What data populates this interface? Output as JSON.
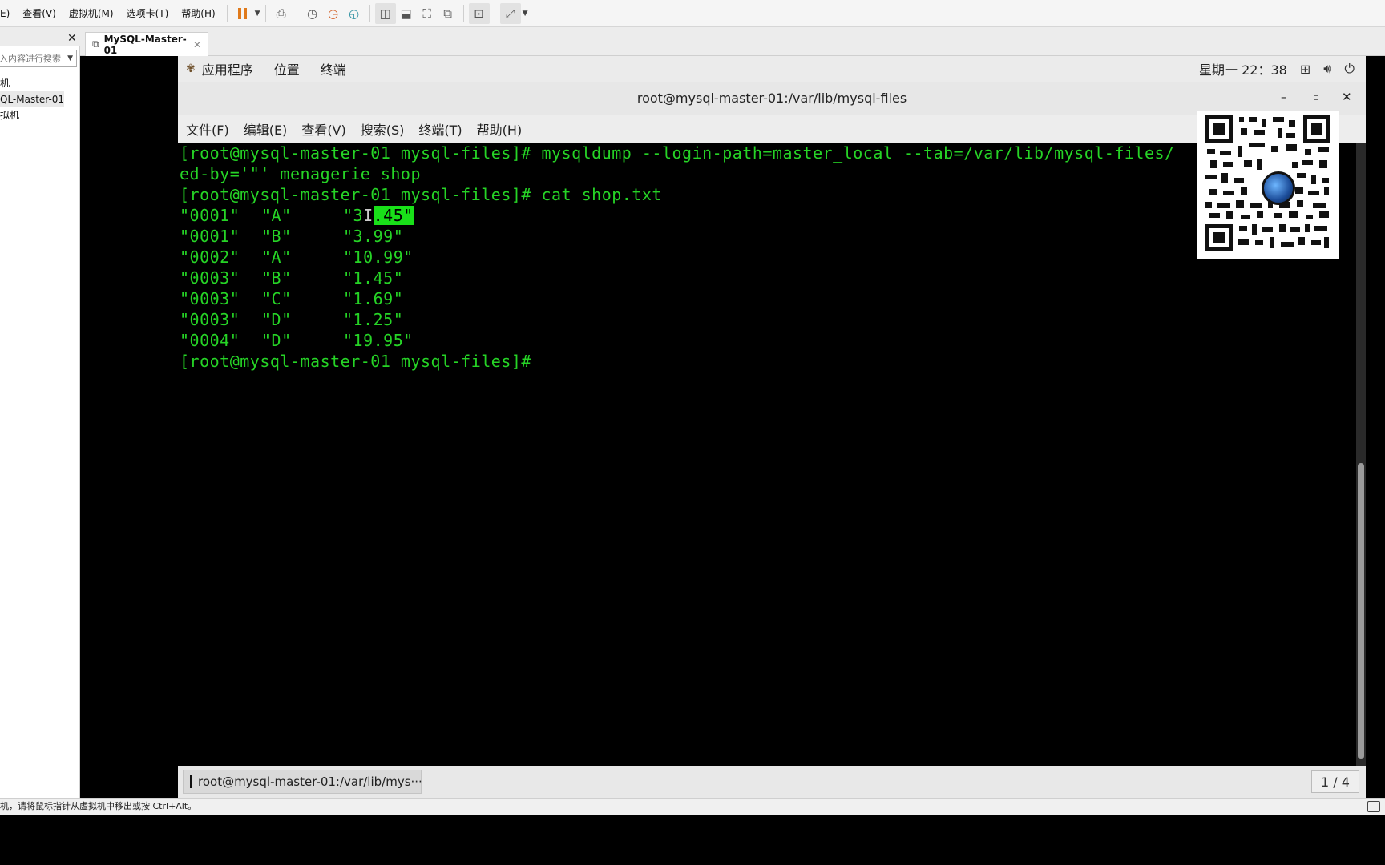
{
  "host": {
    "menu": [
      "E)",
      "查看(V)",
      "虚拟机(M)",
      "选项卡(T)",
      "帮助(H)"
    ],
    "tab_label": "MySQL-Master-01",
    "sidebar": {
      "search_placeholder": "入内容进行搜索",
      "tree": [
        "机",
        "QL-Master-01",
        "拟机"
      ]
    },
    "status_text": "机，请将鼠标指针从虚拟机中移出或按 Ctrl+Alt。"
  },
  "guest": {
    "topbar": {
      "menus": [
        "应用程序",
        "位置",
        "终端"
      ],
      "clock": "星期一 22：38"
    },
    "terminal": {
      "title": "root@mysql-master-01:/var/lib/mysql-files",
      "menu": [
        "文件(F)",
        "编辑(E)",
        "查看(V)",
        "搜索(S)",
        "终端(T)",
        "帮助(H)"
      ],
      "lines": {
        "cmd1": "[root@mysql-master-01 mysql-files]# mysqldump --login-path=master_local --tab=/var/lib/mysql-files/",
        "cmd1_cont": "ed-by='\"' menagerie shop",
        "cmd2": "[root@mysql-master-01 mysql-files]# cat shop.txt",
        "prompt": "[root@mysql-master-01 mysql-files]#"
      },
      "rows": [
        {
          "article": "\"0001\"",
          "dealer": "\"A\"",
          "price": "\"3.45\""
        },
        {
          "article": "\"0001\"",
          "dealer": "\"B\"",
          "price": "\"3.99\""
        },
        {
          "article": "\"0002\"",
          "dealer": "\"A\"",
          "price": "\"10.99\""
        },
        {
          "article": "\"0003\"",
          "dealer": "\"B\"",
          "price": "\"1.45\""
        },
        {
          "article": "\"0003\"",
          "dealer": "\"C\"",
          "price": "\"1.69\""
        },
        {
          "article": "\"0003\"",
          "dealer": "\"D\"",
          "price": "\"1.25\""
        },
        {
          "article": "\"0004\"",
          "dealer": "\"D\"",
          "price": "\"19.95\""
        }
      ],
      "selection_prefix": "\"3",
      "selection_text": ".45\""
    },
    "taskbar": {
      "task_label": "root@mysql-master-01:/var/lib/mys···",
      "workspace": "1 / 4"
    }
  }
}
